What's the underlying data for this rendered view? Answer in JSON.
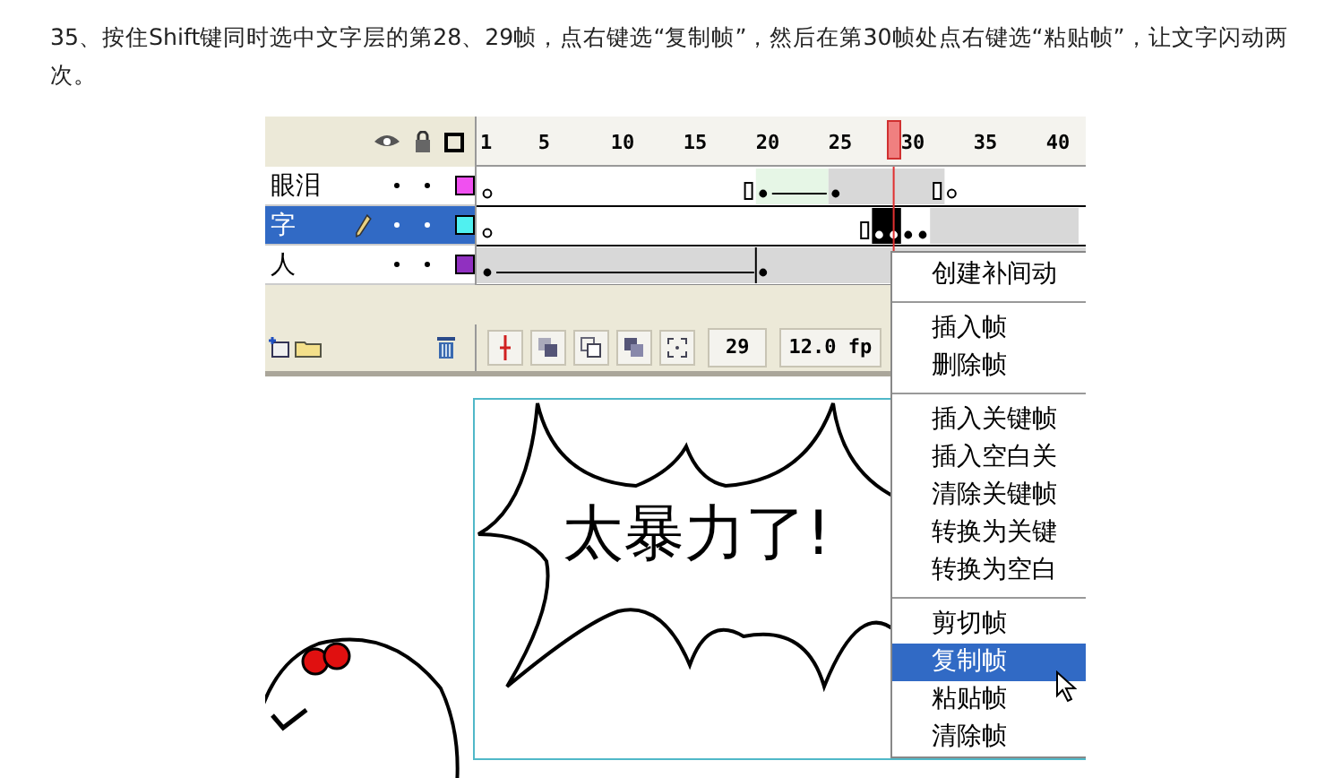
{
  "instruction": "35、按住Shift键同时选中文字层的第28、29帧，点右键选“复制帧”，然后在第30帧处点右键选“粘贴帧”，让文字闪动两次。",
  "timeline": {
    "ruler": [
      "1",
      "5",
      "10",
      "15",
      "20",
      "25",
      "30",
      "35",
      "40"
    ],
    "layers": [
      {
        "name": "眼泪",
        "selected": false,
        "color": "#f050f0"
      },
      {
        "name": "字",
        "selected": true,
        "color": "#50f0f0"
      },
      {
        "name": "人",
        "selected": false,
        "color": "#9030c0"
      }
    ],
    "current_frame": "29",
    "frame_rate": "12.0 fp"
  },
  "stage": {
    "caption": "太暴力了!"
  },
  "context_menu": {
    "items": [
      {
        "kind": "item",
        "label": "创建补间动",
        "selected": false
      },
      {
        "kind": "separator"
      },
      {
        "kind": "item",
        "label": "插入帧",
        "selected": false
      },
      {
        "kind": "item",
        "label": "删除帧",
        "selected": false
      },
      {
        "kind": "separator"
      },
      {
        "kind": "item",
        "label": "插入关键帧",
        "selected": false
      },
      {
        "kind": "item",
        "label": "插入空白关",
        "selected": false
      },
      {
        "kind": "item",
        "label": "清除关键帧",
        "selected": false
      },
      {
        "kind": "item",
        "label": "转换为关键",
        "selected": false
      },
      {
        "kind": "item",
        "label": "转换为空白",
        "selected": false
      },
      {
        "kind": "separator"
      },
      {
        "kind": "item",
        "label": "剪切帧",
        "selected": false
      },
      {
        "kind": "item",
        "label": "复制帧",
        "selected": true
      },
      {
        "kind": "item",
        "label": "粘贴帧",
        "selected": false
      },
      {
        "kind": "item",
        "label": "清除帧",
        "selected": false
      }
    ]
  }
}
